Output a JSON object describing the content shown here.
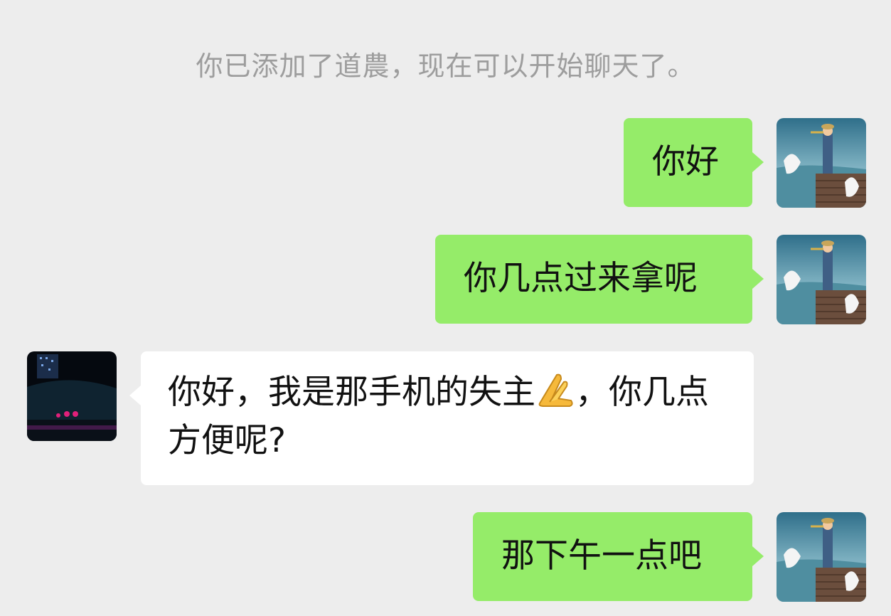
{
  "system_notice": "你已添加了道農，现在可以开始聊天了。",
  "messages": [
    {
      "sender": "me",
      "text": "你好"
    },
    {
      "sender": "me",
      "text": "你几点过来拿呢"
    },
    {
      "sender": "other",
      "text_before_emoji": "你好，我是那手机的失主",
      "emoji": "pressed-hands-emoji",
      "text_after_emoji": "，你几点方便呢?"
    },
    {
      "sender": "me",
      "text": "那下午一点吧"
    }
  ],
  "colors": {
    "background": "#ededed",
    "my_bubble": "#95ec69",
    "their_bubble": "#ffffff",
    "notice_text": "#9d9d9d",
    "message_text": "#111111"
  }
}
